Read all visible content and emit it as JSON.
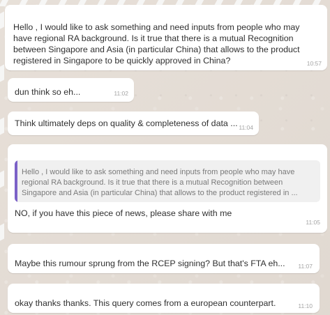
{
  "messages": [
    {
      "text": "Hello , I would like to ask something and need inputs from people who may have regional RA background. Is it true that there is a mutual Recognition between Singapore and Asia (in particular China) that allows to the product registered in Singapore to be quickly approved in China?",
      "time": "10:57"
    },
    {
      "text": "dun think so eh...",
      "time": "11:02"
    },
    {
      "text": "Think ultimately deps on quality & completeness of data ...",
      "time": "11:04"
    },
    {
      "quote": "Hello , I would like to ask something and need inputs from people who may have regional RA background. Is it true that there is a mutual Recognition between Singapore and Asia (in particular China) that allows to the product registered in ...",
      "text": "NO, if you have this piece of news, please share with me",
      "time": "11:05"
    },
    {
      "text": "Maybe this rumour sprung from the RCEP signing? But that's FTA eh...",
      "time": "11:07"
    },
    {
      "text": "okay thanks thanks. This query comes from a european counterpart.",
      "time": "11:10"
    }
  ],
  "colors": {
    "chat_background": "#e5ddd5",
    "bubble": "#ffffff",
    "quote_background": "#f0f0f0",
    "quote_bar": "#7b61c7",
    "text": "#303030",
    "timestamp": "#a4a4a4"
  }
}
